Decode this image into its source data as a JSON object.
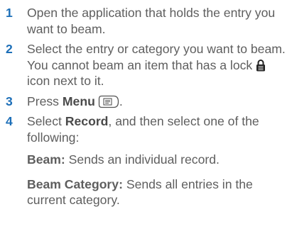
{
  "steps": [
    {
      "number": "1",
      "text": "Open the application that holds the entry you want to beam."
    },
    {
      "number": "2",
      "text_before": "Select the entry or category you want to beam. You cannot beam an item that has a lock",
      "icon": "lock-icon",
      "text_after": "icon next to it."
    },
    {
      "number": "3",
      "prefix": "Press",
      "bold": "Menu",
      "icon": "menu-key-icon"
    },
    {
      "number": "4",
      "prefix": "Select",
      "bold": "Record",
      "suffix": ", and then select one of the following:",
      "options": [
        {
          "term": "Beam:",
          "desc": "Sends an individual record."
        },
        {
          "term": "Beam Category:",
          "desc": "Sends all entries in the current category."
        }
      ]
    }
  ],
  "colors": {
    "step_number": "#1d6fb8",
    "body_text": "#5e5e5e"
  }
}
